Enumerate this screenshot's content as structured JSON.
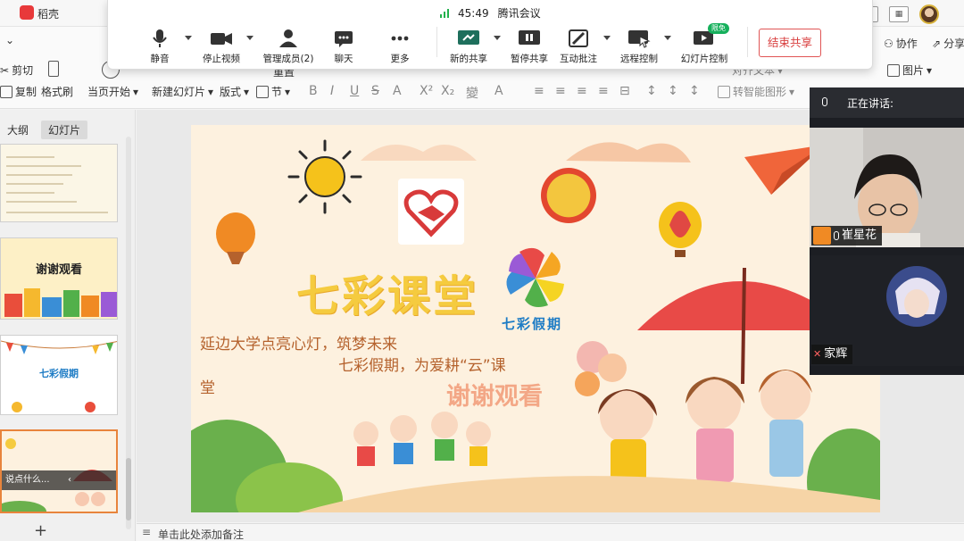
{
  "app": {
    "name": "稻壳"
  },
  "meeting": {
    "timer": "45:49",
    "title": "腾讯会议",
    "buttons": {
      "mute": "静音",
      "stop_video": "停止视频",
      "members": "管理成员(2)",
      "chat": "聊天",
      "more": "更多",
      "new_share": "新的共享",
      "pause_share": "暂停共享",
      "annotate": "互动批注",
      "remote_control": "远程控制",
      "slideshow_control": "幻灯片控制",
      "free_badge": "限免",
      "end_share": "结束共享"
    }
  },
  "ribbon": {
    "cut": "剪切",
    "copy": "复制",
    "format_painter": "格式刷",
    "from_current": "当页开始",
    "new_slide": "新建幻灯片",
    "layout": "版式",
    "section": "节",
    "reset": "重置",
    "smart_graphic": "转智能图形",
    "text_box": "对齐文本",
    "picture": "图片",
    "collaborate": "协作",
    "share": "分享",
    "format_glyphs": [
      "B",
      "I",
      "U",
      "S",
      "A",
      "X²",
      "X₂",
      "變",
      "A"
    ]
  },
  "panel": {
    "tab_outline": "大纲",
    "tab_slides": "幻灯片",
    "thumb_thanks": "谢谢观看",
    "thumb_brand": "七彩假期",
    "thumb_tip": "说点什么...",
    "add": "+"
  },
  "slide": {
    "title": "七彩课堂",
    "brand": "七彩假期",
    "line1": "延边大学点亮心灯，筑梦未来",
    "line2": "七彩假期，为爱耕“云”课",
    "line3": "堂",
    "thanks": "谢谢观看"
  },
  "notes": {
    "placeholder": "单击此处添加备注"
  },
  "speakers": {
    "header": "正在讲话:",
    "participants": [
      {
        "name": "崔星花"
      },
      {
        "name": "家辉"
      }
    ]
  },
  "colors": {
    "accent": "#e8393a",
    "end_share": "#d94040",
    "title_yellow": "#f5cb3f",
    "subtitle_brown": "#b5622d",
    "brand_blue": "#1e7cc5"
  }
}
